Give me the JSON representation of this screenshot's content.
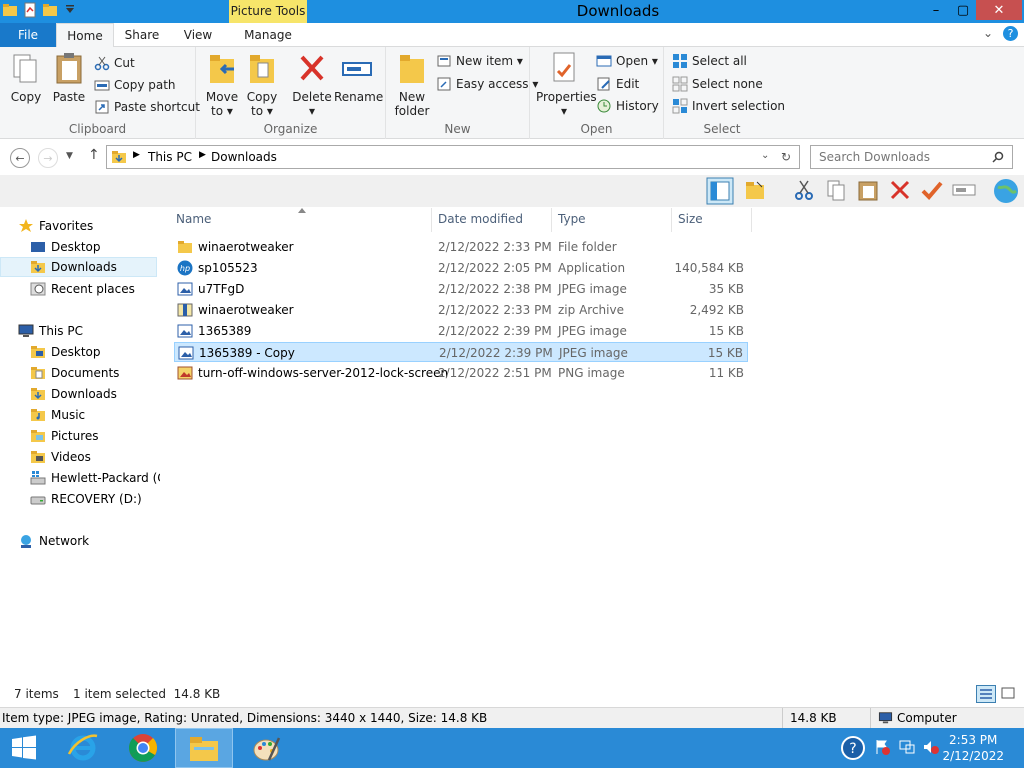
{
  "window": {
    "title": "Downloads",
    "context_tab": "Picture Tools",
    "controls": {
      "minimize": "–",
      "maximize": "▢",
      "close": "✕"
    }
  },
  "ribbon_tabs": {
    "file": "File",
    "home": "Home",
    "share": "Share",
    "view": "View",
    "manage": "Manage"
  },
  "ribbon": {
    "clipboard": {
      "label": "Clipboard",
      "copy": "Copy",
      "paste": "Paste",
      "cut": "Cut",
      "copy_path": "Copy path",
      "paste_shortcut": "Paste shortcut"
    },
    "organize": {
      "label": "Organize",
      "move_to": [
        "Move",
        "to ▾"
      ],
      "copy_to": [
        "Copy",
        "to ▾"
      ],
      "delete": [
        "Delete",
        "▾"
      ],
      "rename": "Rename"
    },
    "new": {
      "label": "New",
      "new_folder": [
        "New",
        "folder"
      ],
      "new_item": "New item ▾",
      "easy_access": "Easy access ▾"
    },
    "open": {
      "label": "Open",
      "properties": [
        "Properties",
        "▾"
      ],
      "open": "Open ▾",
      "edit": "Edit",
      "history": "History"
    },
    "select": {
      "label": "Select",
      "select_all": "Select all",
      "select_none": "Select none",
      "invert": "Invert selection"
    }
  },
  "address": {
    "crumbs": [
      "This PC",
      "Downloads"
    ],
    "search_placeholder": "Search Downloads"
  },
  "nav": {
    "favorites": "Favorites",
    "favorites_items": [
      "Desktop",
      "Downloads",
      "Recent places"
    ],
    "this_pc": "This PC",
    "pc_items": [
      "Desktop",
      "Documents",
      "Downloads",
      "Music",
      "Pictures",
      "Videos",
      "Hewlett-Packard (C:",
      "RECOVERY (D:)"
    ],
    "network": "Network"
  },
  "columns": {
    "name": "Name",
    "date": "Date modified",
    "type": "Type",
    "size": "Size"
  },
  "files": [
    {
      "name": "winaerotweaker",
      "date": "2/12/2022 2:33 PM",
      "type": "File folder",
      "size": ""
    },
    {
      "name": "sp105523",
      "date": "2/12/2022 2:05 PM",
      "type": "Application",
      "size": "140,584 KB"
    },
    {
      "name": "u7TFgD",
      "date": "2/12/2022 2:38 PM",
      "type": "JPEG image",
      "size": "35 KB"
    },
    {
      "name": "winaerotweaker",
      "date": "2/12/2022 2:33 PM",
      "type": "zip Archive",
      "size": "2,492 KB"
    },
    {
      "name": "1365389",
      "date": "2/12/2022 2:39 PM",
      "type": "JPEG image",
      "size": "15 KB"
    },
    {
      "name": "1365389 - Copy",
      "date": "2/12/2022 2:39 PM",
      "type": "JPEG image",
      "size": "15 KB"
    },
    {
      "name": "turn-off-windows-server-2012-lock-screen",
      "date": "2/12/2022 2:51 PM",
      "type": "PNG image",
      "size": "11 KB"
    }
  ],
  "status": {
    "count": "7 items",
    "selected": "1 item selected  14.8 KB"
  },
  "details": {
    "info": "Item type: JPEG image, Rating: Unrated, Dimensions: 3440 x 1440, Size: 14.8 KB",
    "size": "14.8 KB",
    "location": "Computer"
  },
  "taskbar": {
    "time": "2:53 PM",
    "date": "2/12/2022"
  },
  "colors": {
    "titlebar": "#1e8fe0",
    "file_tab": "#1979ca",
    "selection": "#cce8ff",
    "taskbar": "#2a8ad6",
    "context_tab": "#f7e56a"
  }
}
